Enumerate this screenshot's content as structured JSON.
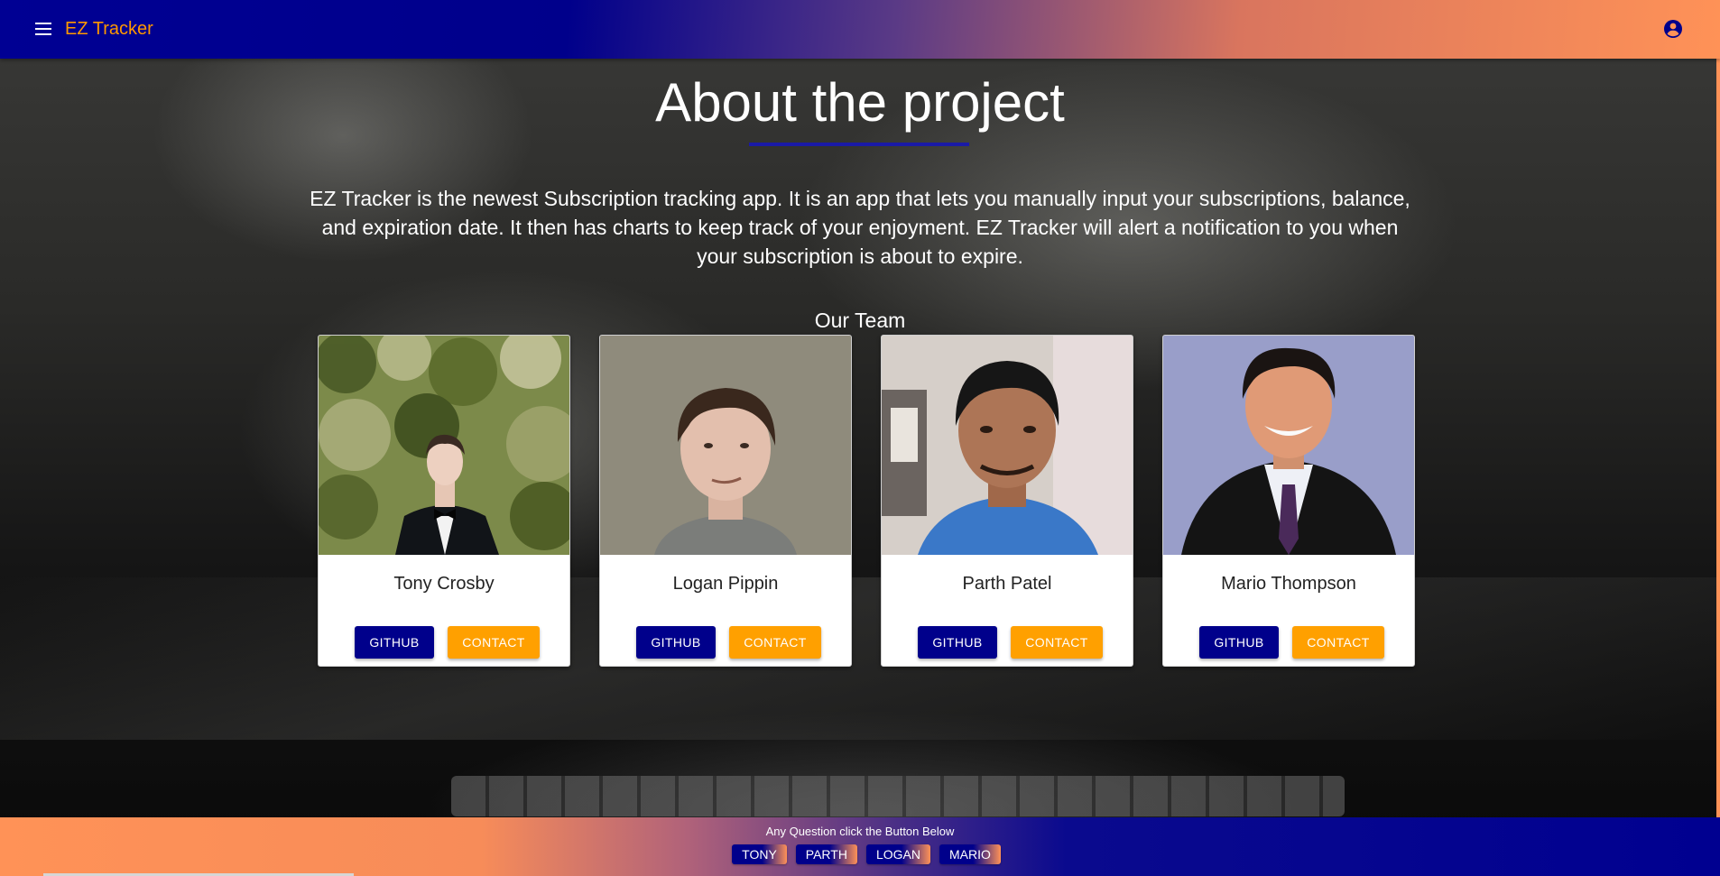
{
  "app": {
    "title": "EZ Tracker",
    "colors": {
      "navy": "#00008b",
      "orange": "#ff9800",
      "contact_orange": "#ffa000",
      "gradient_end": "#ff9257"
    }
  },
  "header": {
    "menu_icon": "menu-icon",
    "account_icon": "account-circle-icon"
  },
  "main": {
    "heading": "About the project",
    "description": "EZ Tracker is the newest Subscription tracking app. It is an app that lets you manually input your subscriptions, balance, and expiration date. It then has charts to keep track of your enjoyment. EZ Tracker will alert a notification to you when your subscription is about to expire.",
    "team_heading": "Our Team",
    "team": [
      {
        "name": "Tony Crosby",
        "github_label": "GITHUB",
        "contact_label": "CONTACT"
      },
      {
        "name": "Logan Pippin",
        "github_label": "GITHUB",
        "contact_label": "CONTACT"
      },
      {
        "name": "Parth Patel",
        "github_label": "GITHUB",
        "contact_label": "CONTACT"
      },
      {
        "name": "Mario Thompson",
        "github_label": "GITHUB",
        "contact_label": "CONTACT"
      }
    ]
  },
  "footer": {
    "text": "Any Question click the Button Below",
    "buttons": [
      "TONY",
      "PARTH",
      "LOGAN",
      "MARIO"
    ]
  }
}
